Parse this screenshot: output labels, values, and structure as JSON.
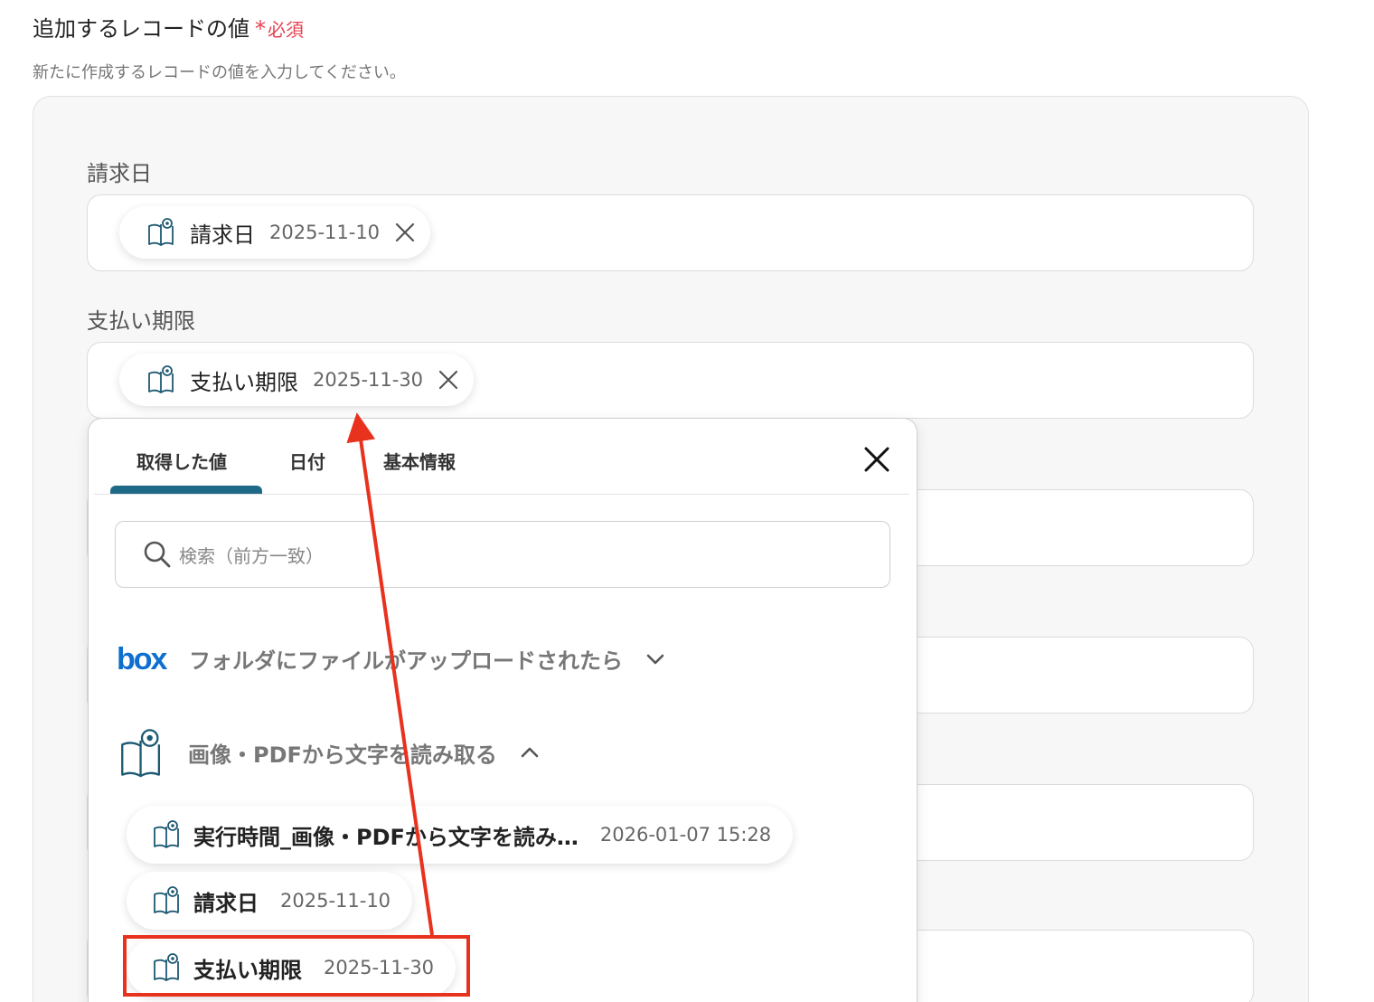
{
  "section": {
    "title": "追加するレコードの値",
    "required_star": "*",
    "required_label": "必須",
    "description": "新たに作成するレコードの値を入力してください。"
  },
  "fields": [
    {
      "label": "請求日",
      "chip": {
        "label": "請求日",
        "value": "2025-11-10"
      }
    },
    {
      "label": "支払い期限",
      "chip": {
        "label": "支払い期限",
        "value": "2025-11-30"
      }
    }
  ],
  "popover": {
    "tabs": [
      {
        "label": "取得した値",
        "active": true
      },
      {
        "label": "日付",
        "active": false
      },
      {
        "label": "基本情報",
        "active": false
      }
    ],
    "search": {
      "placeholder": "検索（前方一致）"
    },
    "groups": [
      {
        "logo": "box",
        "title": "フォルダにファイルがアップロードされたら",
        "expanded": false
      },
      {
        "logo": "ocr-book-eye",
        "title": "画像・PDFから文字を読み取る",
        "expanded": true
      }
    ],
    "items": [
      {
        "label": "実行時間_画像・PDFから文字を読み…",
        "value": "2026-01-07 15:28"
      },
      {
        "label": "請求日",
        "value": "2025-11-10"
      },
      {
        "label": "支払い期限",
        "value": "2025-11-30",
        "highlighted": true
      }
    ]
  },
  "colors": {
    "required": "#e8404f",
    "tab_underline": "#1e6a86",
    "box_logo": "#0f6fcf",
    "icon_stroke": "#1e5a73",
    "annotation": "#e8321e"
  }
}
